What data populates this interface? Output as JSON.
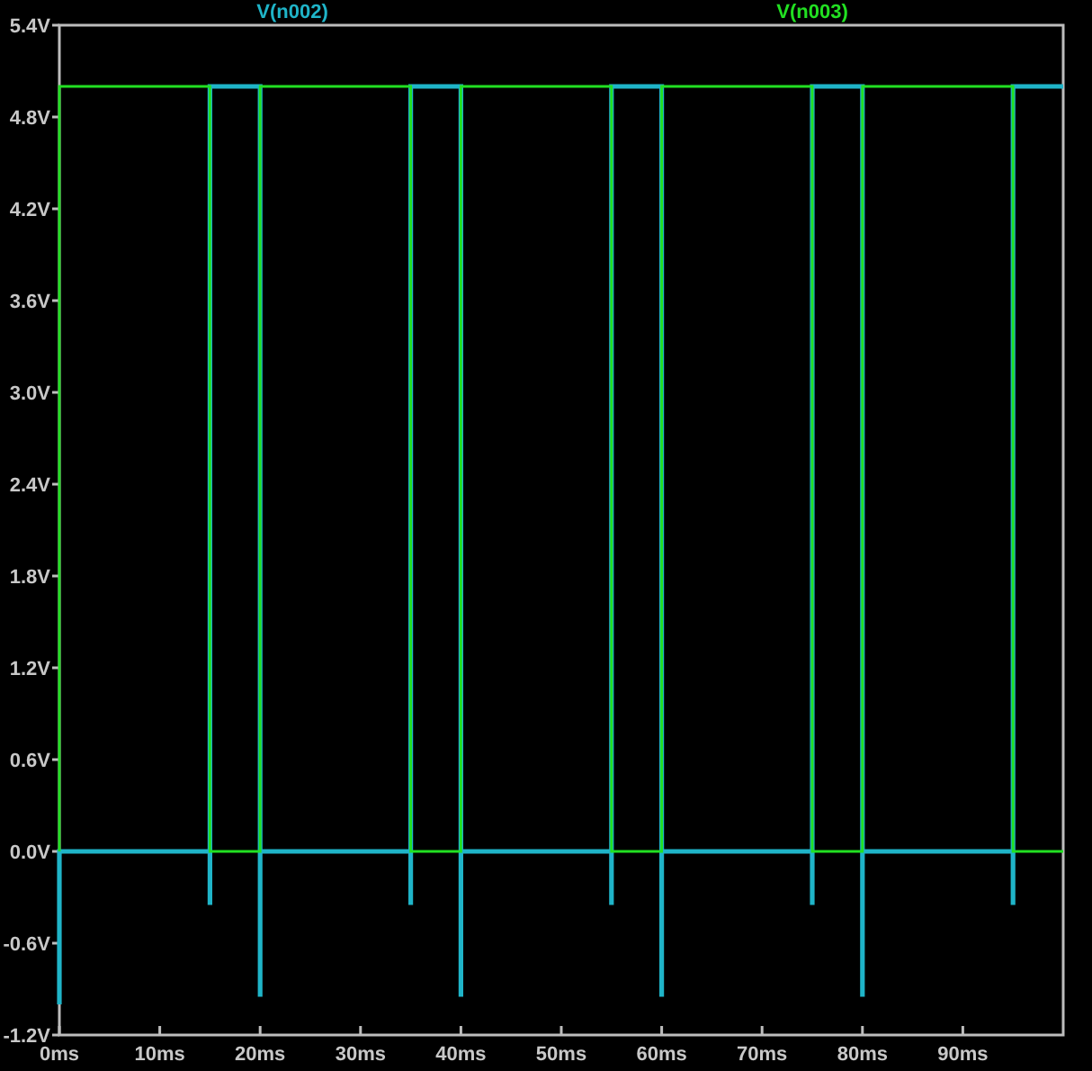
{
  "chart_data": {
    "type": "line",
    "xlim": [
      0,
      100
    ],
    "ylim": [
      -1.2,
      5.4
    ],
    "xticks": [
      {
        "value": 0,
        "label": "0ms"
      },
      {
        "value": 10,
        "label": "10ms"
      },
      {
        "value": 20,
        "label": "20ms"
      },
      {
        "value": 30,
        "label": "30ms"
      },
      {
        "value": 40,
        "label": "40ms"
      },
      {
        "value": 50,
        "label": "50ms"
      },
      {
        "value": 60,
        "label": "60ms"
      },
      {
        "value": 70,
        "label": "70ms"
      },
      {
        "value": 80,
        "label": "80ms"
      },
      {
        "value": 90,
        "label": "90ms"
      }
    ],
    "yticks": [
      {
        "value": -1.2,
        "label": "-1.2V"
      },
      {
        "value": -0.6,
        "label": "-0.6V"
      },
      {
        "value": 0,
        "label": "0.0V"
      },
      {
        "value": 0.6,
        "label": "0.6V"
      },
      {
        "value": 1.2,
        "label": "1.2V"
      },
      {
        "value": 1.8,
        "label": "1.8V"
      },
      {
        "value": 2.4,
        "label": "2.4V"
      },
      {
        "value": 3.0,
        "label": "3.0V"
      },
      {
        "value": 3.6,
        "label": "3.6V"
      },
      {
        "value": 4.2,
        "label": "4.2V"
      },
      {
        "value": 4.8,
        "label": "4.8V"
      },
      {
        "value": 5.4,
        "label": "5.4V"
      }
    ],
    "x": [
      0,
      0,
      15,
      15,
      15,
      20,
      20,
      20,
      35,
      35,
      35,
      40,
      40,
      40,
      55,
      55,
      55,
      60,
      60,
      60,
      75,
      75,
      75,
      80,
      80,
      80,
      95,
      95,
      95,
      100
    ],
    "series": [
      {
        "name": "V(n002)",
        "color": "#1fb4c8",
        "values": [
          -1,
          0,
          0,
          -0.35,
          5,
          5,
          -0.95,
          0,
          0,
          -0.35,
          5,
          5,
          -0.95,
          0,
          0,
          -0.35,
          5,
          5,
          -0.95,
          0,
          0,
          -0.35,
          5,
          5,
          -0.95,
          0,
          0,
          -0.35,
          5,
          5
        ]
      },
      {
        "name": "V(n003)",
        "color": "#22e022",
        "values": [
          0,
          5,
          5,
          0,
          0,
          0,
          5,
          5,
          5,
          0,
          0,
          0,
          5,
          5,
          5,
          0,
          0,
          0,
          5,
          5,
          5,
          0,
          0,
          0,
          5,
          5,
          5,
          0,
          0,
          0
        ]
      }
    ]
  }
}
